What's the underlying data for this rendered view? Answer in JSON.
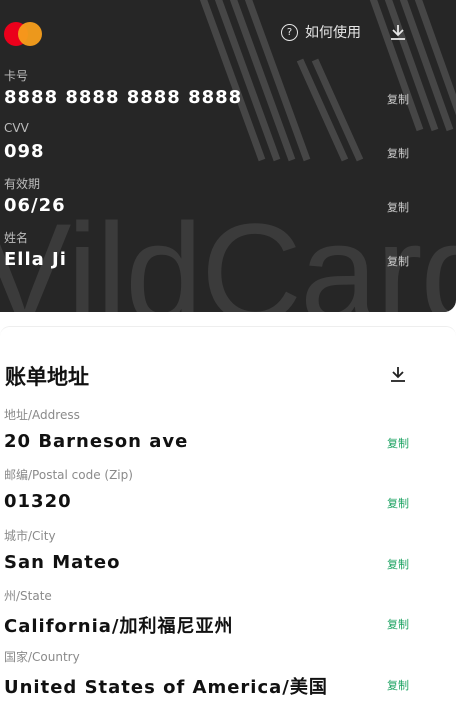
{
  "card": {
    "brand": "mastercard",
    "help_label": "如何使用",
    "watermark": "VildCard",
    "copy_label": "复制",
    "fields": [
      {
        "label": "卡号",
        "value": "8888 8888 8888 8888"
      },
      {
        "label": "CVV",
        "value": "098"
      },
      {
        "label": "有效期",
        "value": "06/26"
      },
      {
        "label": "姓名",
        "value": "Ella Ji"
      }
    ]
  },
  "billing": {
    "title": "账单地址",
    "copy_label": "复制",
    "fields": [
      {
        "label": "地址/Address",
        "value": "20 Barneson ave"
      },
      {
        "label": "邮编/Postal code (Zip)",
        "value": "01320"
      },
      {
        "label": "城市/City",
        "value": "San Mateo"
      },
      {
        "label": "州/State",
        "value": "California/加利福尼亚州"
      },
      {
        "label": "国家/Country",
        "value": "United States of America/美国"
      }
    ]
  },
  "icons": {
    "help": "question-circle-icon",
    "download": "download-icon"
  },
  "colors": {
    "card_bg": "#262626",
    "copy_green": "#1aa260",
    "mastercard_red": "#eb001b",
    "mastercard_orange": "#f79e1b"
  }
}
